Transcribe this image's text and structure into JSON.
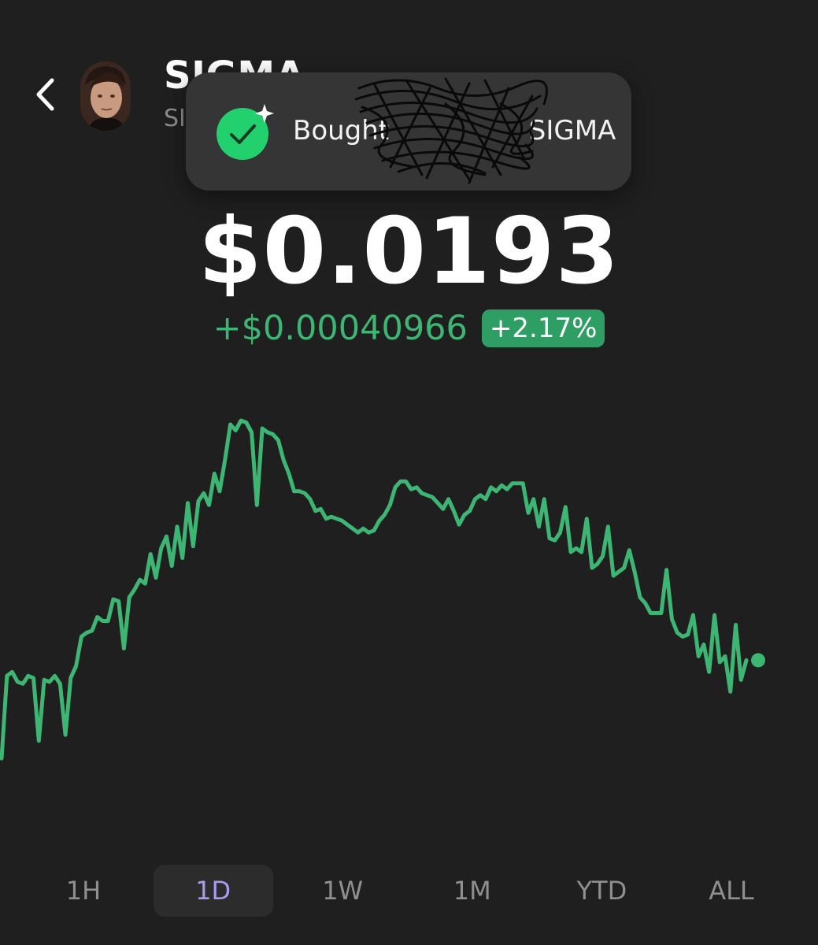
{
  "header": {
    "token_name": "SIGMA",
    "token_symbol": "SI",
    "back_icon": "chevron-left-icon",
    "avatar_icon": "token-avatar"
  },
  "toast": {
    "icon": "check-sparkle-icon",
    "text_start": "Bought",
    "text_end": "SIGMA"
  },
  "price": {
    "value": "$0.0193",
    "change_abs": "+$0.00040966",
    "change_pct": "+2.17%"
  },
  "colors": {
    "background": "#1f1f1f",
    "accent_green": "#3db573",
    "badge_green": "#2e9e64",
    "active_range": "#a99bf0",
    "toast_bg": "#353535"
  },
  "chart_data": {
    "type": "line",
    "grid": false,
    "values": [
      0.01878,
      0.0192,
      0.01922,
      0.01917,
      0.01916,
      0.0192,
      0.01919,
      0.01887,
      0.01918,
      0.01917,
      0.0192,
      0.01916,
      0.0189,
      0.01919,
      0.01925,
      0.0194,
      0.01942,
      0.01943,
      0.0195,
      0.01948,
      0.01948,
      0.01959,
      0.01958,
      0.01934,
      0.0196,
      0.01964,
      0.01969,
      0.01967,
      0.01982,
      0.0197,
      0.01985,
      0.01991,
      0.01976,
      0.01996,
      0.0198,
      0.02008,
      0.01986,
      0.02009,
      0.02013,
      0.02007,
      0.02023,
      0.02014,
      0.0203,
      0.02048,
      0.02045,
      0.0205,
      0.02049,
      0.02044,
      0.02007,
      0.02046,
      0.02044,
      0.02043,
      0.0204,
      0.0203,
      0.02023,
      0.02014,
      0.02014,
      0.02013,
      0.0201,
      0.02004,
      0.02005,
      0.02,
      0.02001,
      0.02,
      0.01999,
      0.01997,
      0.01995,
      0.01993,
      0.01995,
      0.01993,
      0.01994,
      0.01999,
      0.02002,
      0.02007,
      0.02016,
      0.02019,
      0.02019,
      0.02015,
      0.02016,
      0.02013,
      0.02012,
      0.02011,
      0.02008,
      0.02005,
      0.0201,
      0.02004,
      0.01997,
      0.02002,
      0.02004,
      0.0201,
      0.02012,
      0.0201,
      0.02016,
      0.02014,
      0.02017,
      0.02015,
      0.02018,
      0.02018,
      0.02018,
      0.02003,
      0.0201,
      0.01996,
      0.0201,
      0.0199,
      0.01989,
      0.01993,
      0.02006,
      0.01983,
      0.01985,
      0.01983,
      0.02,
      0.01975,
      0.01977,
      0.01981,
      0.01996,
      0.01971,
      0.01973,
      0.01975,
      0.01984,
      0.01973,
      0.0196,
      0.01957,
      0.01952,
      0.01952,
      0.01952,
      0.01974,
      0.01949,
      0.01942,
      0.0194,
      0.01941,
      0.01951,
      0.0193,
      0.01936,
      0.01922,
      0.01951,
      0.01927,
      0.0193,
      0.01912,
      0.01946,
      0.01918,
      0.01928
    ]
  },
  "time_ranges": {
    "selected": "1D",
    "items": [
      {
        "label": "1H",
        "active": false
      },
      {
        "label": "1D",
        "active": true
      },
      {
        "label": "1W",
        "active": false
      },
      {
        "label": "1M",
        "active": false
      },
      {
        "label": "YTD",
        "active": false
      },
      {
        "label": "ALL",
        "active": false
      }
    ]
  }
}
